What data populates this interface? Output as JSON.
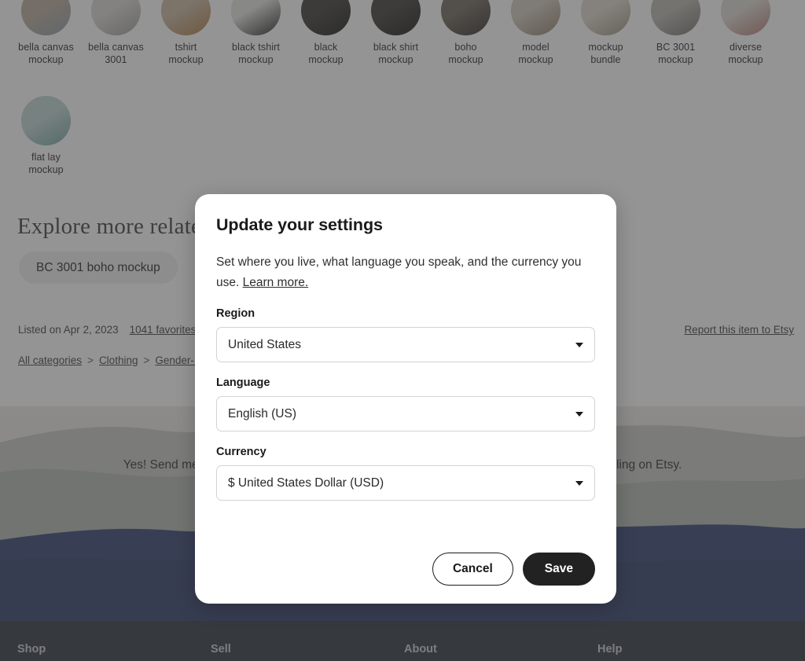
{
  "thumbnails": {
    "row1": [
      {
        "label": "bella canvas\nmockup",
        "line1": "bella canvas",
        "line2": "mockup",
        "c1": "#b9a99a",
        "c2": "#8c9aa0"
      },
      {
        "label": "bella canvas 3001",
        "line1": "bella canvas",
        "line2": "3001",
        "c1": "#d8d6d2",
        "c2": "#9b9b96"
      },
      {
        "label": "tshirt mockup",
        "line1": "tshirt",
        "line2": "mockup",
        "c1": "#c8b49e",
        "c2": "#a8793f"
      },
      {
        "label": "black tshirt mockup",
        "line1": "black tshirt",
        "line2": "mockup",
        "c1": "#e4e3e1",
        "c2": "#1d1d1d"
      },
      {
        "label": "black mockup",
        "line1": "black",
        "line2": "mockup",
        "c1": "#3a3632",
        "c2": "#141414"
      },
      {
        "label": "black shirt mockup",
        "line1": "black shirt",
        "line2": "mockup",
        "c1": "#3b3733",
        "c2": "#111111"
      },
      {
        "label": "boho mockup",
        "line1": "boho",
        "line2": "mockup",
        "c1": "#6b6257",
        "c2": "#2a2723"
      },
      {
        "label": "model mockup",
        "line1": "model",
        "line2": "mockup",
        "c1": "#cfc6ba",
        "c2": "#8e7d6b"
      },
      {
        "label": "mockup bundle",
        "line1": "mockup",
        "line2": "bundle",
        "c1": "#ded7cc",
        "c2": "#9a8d7d"
      },
      {
        "label": "BC 3001 mockup",
        "line1": "BC 3001",
        "line2": "mockup",
        "c1": "#b9b5ae",
        "c2": "#6f6c66"
      },
      {
        "label": "diverse mockup",
        "line1": "diverse",
        "line2": "mockup",
        "c1": "#ddd9d2",
        "c2": "#b0776f"
      }
    ],
    "row2": [
      {
        "label": "flat lay mockup",
        "line1": "flat lay",
        "line2": "mockup",
        "c1": "#bcd4d2",
        "c2": "#6fa3a0"
      }
    ]
  },
  "explore": {
    "title": "Explore more related",
    "chip": "BC 3001 boho mockup"
  },
  "listing": {
    "listed_on": "Listed on Apr 2, 2023",
    "favorites": "1041 favorites",
    "report": "Report this item to Etsy"
  },
  "breadcrumb": {
    "items": [
      "All categories",
      "Clothing",
      "Gender-Ne"
    ],
    "separator": ">"
  },
  "banner": {
    "text": "Yes! Send me exclusive offers, unique gift ideas, and personalized tips for shopping and selling on Etsy."
  },
  "footer": {
    "columns": [
      "Shop",
      "Sell",
      "About",
      "Help"
    ]
  },
  "modal": {
    "title": "Update your settings",
    "description_before": "Set where you live, what language you speak, and the currency you use. ",
    "learn_more": "Learn more.",
    "fields": [
      {
        "label": "Region",
        "value": "United States"
      },
      {
        "label": "Language",
        "value": "English (US)"
      },
      {
        "label": "Currency",
        "value": "$ United States Dollar (USD)"
      }
    ],
    "cancel_label": "Cancel",
    "save_label": "Save"
  },
  "colors": {
    "save_button": "#222222",
    "footer_bg": "#2b333c",
    "overlay": "rgba(64,64,64,0.56)"
  }
}
